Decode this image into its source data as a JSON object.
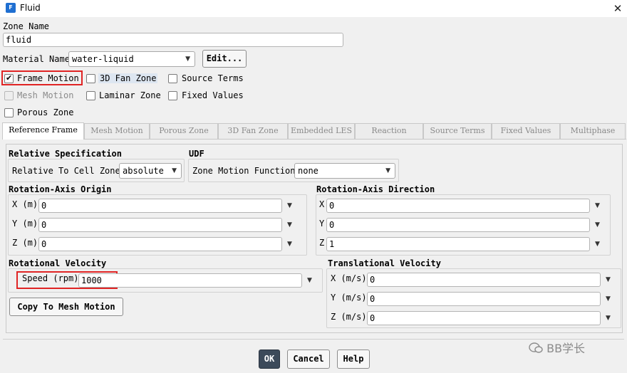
{
  "window": {
    "title": "Fluid",
    "app_icon": "F"
  },
  "zone_name": {
    "label": "Zone Name",
    "value": "fluid"
  },
  "material": {
    "label": "Material Name",
    "value": "water-liquid",
    "edit_label": "Edit..."
  },
  "options": {
    "frame_motion": "Frame Motion",
    "fan_zone": "3D Fan Zone",
    "source_terms": "Source Terms",
    "mesh_motion": "Mesh Motion",
    "laminar_zone": "Laminar Zone",
    "fixed_values": "Fixed Values",
    "porous_zone": "Porous Zone"
  },
  "tabs": [
    "Reference Frame",
    "Mesh Motion",
    "Porous Zone",
    "3D Fan Zone",
    "Embedded LES",
    "Reaction",
    "Source Terms",
    "Fixed Values",
    "Multiphase"
  ],
  "relative_spec": {
    "title": "Relative Specification",
    "label": "Relative To Cell Zone",
    "value": "absolute"
  },
  "udf": {
    "title": "UDF",
    "label": "Zone Motion Function",
    "value": "none"
  },
  "origin": {
    "title": "Rotation-Axis Origin",
    "x_label": "X (m)",
    "x": "0",
    "y_label": "Y (m)",
    "y": "0",
    "z_label": "Z (m)",
    "z": "0"
  },
  "direction": {
    "title": "Rotation-Axis Direction",
    "x_label": "X",
    "x": "0",
    "y_label": "Y",
    "y": "0",
    "z_label": "Z",
    "z": "1"
  },
  "rotational": {
    "title": "Rotational Velocity",
    "speed_label": "Speed (rpm)",
    "speed": "1000",
    "copy_label": "Copy To Mesh Motion"
  },
  "translational": {
    "title": "Translational Velocity",
    "x_label": "X (m/s)",
    "x": "0",
    "y_label": "Y (m/s)",
    "y": "0",
    "z_label": "Z (m/s)",
    "z": "0"
  },
  "footer": {
    "ok": "OK",
    "cancel": "Cancel",
    "help": "Help"
  },
  "watermark": "BB学长",
  "colors": {
    "highlight": "#e02424",
    "ok_button": "#3c4a5a"
  }
}
